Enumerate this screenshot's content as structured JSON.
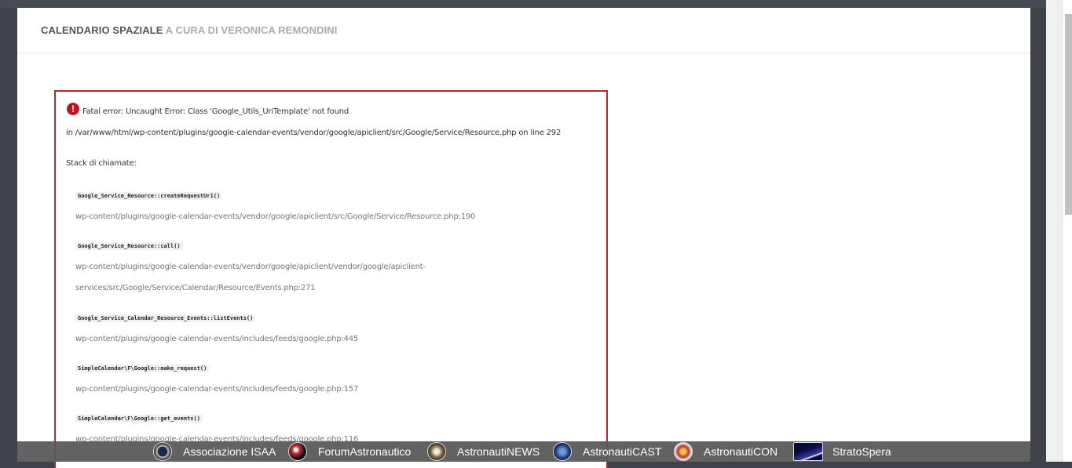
{
  "header": {
    "title_main": "CALENDARIO SPAZIALE",
    "title_accent": "A CURA DI VERONICA REMONDINI"
  },
  "error": {
    "icon": "exclamation-circle-icon",
    "message": "Fatal error: Uncaught Error: Class 'Google_Utils_UriTemplate' not found",
    "location": "in /var/www/html/wp-content/plugins/google-calendar-events/vendor/google/apiclient/src/Google/Service/Resource.php on line 292",
    "stack_title": "Stack di chiamate:",
    "frames": [
      {
        "fn": "Google_Service_Resource::createRequestUri()",
        "file": "wp-content/plugins/google-calendar-events/vendor/google/apiclient/src/Google/Service/Resource.php:190"
      },
      {
        "fn": "Google_Service_Resource::call()",
        "file": "wp-content/plugins/google-calendar-events/vendor/google/apiclient/vendor/google/apiclient-",
        "file2": "services/src/Google/Service/Calendar/Resource/Events.php:271"
      },
      {
        "fn": "Google_Service_Calendar_Resource_Events::listEvents()",
        "file": "wp-content/plugins/google-calendar-events/includes/feeds/google.php:445"
      },
      {
        "fn": "SimpleCalendar\\F\\Google::make_request()",
        "file": "wp-content/plugins/google-calendar-events/includes/feeds/google.php:157"
      },
      {
        "fn": "SimpleCalendar\\F\\Google::get_events()",
        "file": "wp-content/plugins/google-calendar-events/includes/feeds/google.php:116"
      }
    ]
  },
  "bottom_bar": {
    "items": [
      {
        "label": "Associazione ISAA",
        "icon": "isaa-logo-icon"
      },
      {
        "label": "ForumAstronautico",
        "icon": "forum-logo-icon"
      },
      {
        "label": "AstronautiNEWS",
        "icon": "news-logo-icon"
      },
      {
        "label": "AstronautiCAST",
        "icon": "cast-logo-icon"
      },
      {
        "label": "AstronautiCON",
        "icon": "con-logo-icon"
      },
      {
        "label": "StratoSpera",
        "icon": "stratospera-logo-icon"
      }
    ]
  },
  "colors": {
    "error_border": "#b3272e",
    "error_icon": "#c0141d",
    "title_accent": "#aaaaaa",
    "bottom_bar": "#5a5a5a"
  }
}
